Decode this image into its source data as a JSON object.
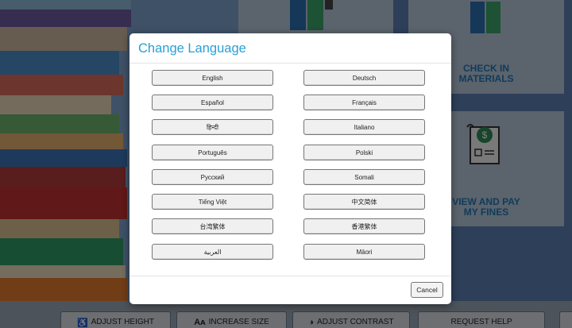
{
  "background": {
    "tiles": [
      {
        "label_1": "CHECK IN",
        "label_2": "MATERIALS"
      },
      {
        "label_1": "VIEW AND PAY",
        "label_2": "MY FINES"
      }
    ],
    "bottom_buttons": [
      {
        "icon": "♿",
        "label": "ADJUST HEIGHT"
      },
      {
        "icon": "Aᴀ",
        "label": "INCREASE SIZE"
      },
      {
        "icon": "◑",
        "label": "ADJUST CONTRAST"
      },
      {
        "icon": "",
        "label": "REQUEST HELP"
      }
    ]
  },
  "modal": {
    "title": "Change Language",
    "languages": [
      "English",
      "Deutsch",
      "Español",
      "Français",
      "हिन्दी",
      "Italiano",
      "Português",
      "Polski",
      "Русский",
      "Somali",
      "Tiếng Việt",
      "中文简体",
      "台湾繁体",
      "香港繁体",
      "العربية",
      "Māori"
    ],
    "cancel_label": "Cancel"
  },
  "colors": {
    "accent": "#2a9fd6",
    "tile_text": "#1f78b4",
    "fine_icon": "#2e8b57"
  }
}
